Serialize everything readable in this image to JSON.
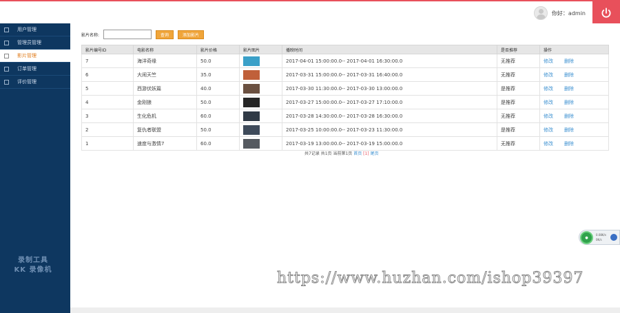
{
  "header": {
    "greeting": "你好：admin",
    "power_icon": "power-icon",
    "avatar_icon": "user-avatar-icon"
  },
  "sidebar": {
    "items": [
      {
        "label": "用户管理",
        "active": false
      },
      {
        "label": "管理员管理",
        "active": false
      },
      {
        "label": "影片管理",
        "active": true
      },
      {
        "label": "订单管理",
        "active": false
      },
      {
        "label": "评价管理",
        "active": false
      }
    ],
    "watermark_line1": "录制工具",
    "watermark_line2": "KK 录像机"
  },
  "toolbar": {
    "search_label": "影片名称:",
    "search_value": "",
    "query_button": "查询",
    "add_button": "添加影片"
  },
  "table": {
    "columns": [
      "影片编号ID",
      "电影名称",
      "影片价格",
      "影片图片",
      "播映时间",
      "是否推荐",
      "操作"
    ],
    "rows": [
      {
        "id": "7",
        "name": "海洋奇缘",
        "price": "50.0",
        "time": "2017-04-01 15:00:00.0-- 2017-04-01 16:30:00.0",
        "recommend": "无推荐"
      },
      {
        "id": "6",
        "name": "大闹天竺",
        "price": "35.0",
        "time": "2017-03-31 15:00:00.0-- 2017-03-31 16:40:00.0",
        "recommend": "无推荐"
      },
      {
        "id": "5",
        "name": "西游伏妖篇",
        "price": "40.0",
        "time": "2017-03-30 11:30:00.0-- 2017-03-30 13:00:00.0",
        "recommend": "是推荐"
      },
      {
        "id": "4",
        "name": "金刚狼",
        "price": "50.0",
        "time": "2017-03-27 15:00:00.0-- 2017-03-27 17:10:00.0",
        "recommend": "是推荐"
      },
      {
        "id": "3",
        "name": "生化危机",
        "price": "60.0",
        "time": "2017-03-28 14:30:00.0-- 2017-03-28 16:30:00.0",
        "recommend": "无推荐"
      },
      {
        "id": "2",
        "name": "复仇者联盟",
        "price": "50.0",
        "time": "2017-03-25 10:00:00.0-- 2017-03-23 11:30:00.0",
        "recommend": "是推荐"
      },
      {
        "id": "1",
        "name": "速度与激情7",
        "price": "60.0",
        "time": "2017-03-19 13:00:00.0-- 2017-03-19 15:00:00.0",
        "recommend": "无推荐"
      }
    ],
    "edit_label": "修改",
    "delete_label": "删除",
    "thumb_colors": [
      "#3aa0c8",
      "#c0603a",
      "#6a5040",
      "#262626",
      "#303a46",
      "#3e4a5a",
      "#555a60"
    ]
  },
  "pager": {
    "summary": "共7记录 共1页 当前第1页",
    "first": "首页",
    "current": "[1]",
    "last": "尾页"
  },
  "watermark_url": "https://www.huzhan.com/ishop39397",
  "float_widget": {
    "line1": "0.08K/s",
    "line2": "0K/s"
  },
  "colors": {
    "sidebar_bg": "#0e3760",
    "accent_red": "#e8505b",
    "accent_orange": "#f0a53a",
    "link_blue": "#3a8fd0"
  }
}
